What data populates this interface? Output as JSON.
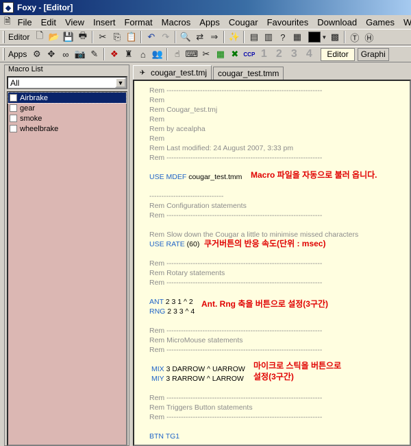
{
  "window": {
    "title": "Foxy - [Editor]"
  },
  "menu": [
    "File",
    "Edit",
    "View",
    "Insert",
    "Format",
    "Macros",
    "Apps",
    "Cougar",
    "Favourites",
    "Download",
    "Games",
    "W"
  ],
  "toolbar1": {
    "label": "Editor"
  },
  "toolbar2": {
    "label": "Apps",
    "numbers": [
      "1",
      "2",
      "3",
      "4"
    ],
    "editor_button": "Editor",
    "graphic_button": "Graphi"
  },
  "macro_panel": {
    "title": "Macro List",
    "filter": "All",
    "items": [
      {
        "label": "Airbrake",
        "selected": true
      },
      {
        "label": "gear",
        "selected": false
      },
      {
        "label": "smoke",
        "selected": false
      },
      {
        "label": "wheelbrake",
        "selected": false
      }
    ]
  },
  "tabs": [
    {
      "label": "cougar_test.tmj",
      "active": true
    },
    {
      "label": "cougar_test.tmm",
      "active": false
    }
  ],
  "editor": {
    "lines": {
      "l1": "Rem -----------------------------------------------------------------",
      "l2": "Rem",
      "l3": "Rem    Cougar_test.tmj",
      "l4": "Rem",
      "l5": "Rem    by acealpha",
      "l6": "Rem",
      "l7": "Rem    Last modified: 24 August 2007, 3:33 pm",
      "l8": "Rem -----------------------------------------------------------------",
      "use_mdef_kw": "USE MDEF",
      "use_mdef_val": "cougar_test.tmm",
      "l10": "-------------------------------",
      "l11": "Rem       Configuration statements",
      "l12": "Rem -----------------------------------------------------------------",
      "l13": "Rem Slow down the Cougar a little to minimise missed characters",
      "use_rate_kw": "USE RATE",
      "use_rate_val": "(60)",
      "l15": "Rem -----------------------------------------------------------------",
      "l16": "Rem         Rotary statements",
      "l17": "Rem -----------------------------------------------------------------",
      "ant_kw": "ANT",
      "ant_val": "2 3 1 ^ 2",
      "rng_kw": "RNG",
      "rng_val": "2 3 3 ^ 4",
      "l20": "Rem -----------------------------------------------------------------",
      "l21": "Rem       MicroMouse statements",
      "l22": "Rem -----------------------------------------------------------------",
      "mix_kw": "MIX",
      "mix_val": "3  DARROW ^ UARROW",
      "miy_kw": "MIY",
      "miy_val": "3  RARROW ^ LARROW",
      "l25": "Rem -----------------------------------------------------------------",
      "l26": "Rem       Triggers Button statements",
      "l27": "Rem -----------------------------------------------------------------",
      "btn_kw": "BTN TG1"
    },
    "notes": {
      "n1": "Macro 파일을 자동으로 불러 옵니다.",
      "n2": "쿠거버튼의 반응 속도(단위 : msec)",
      "n3": "Ant. Rng 축을 버튼으로 설정(3구간)",
      "n4a": "마이크로 스틱을 버튼으로",
      "n4b": "설정(3구간)"
    }
  },
  "colors": {
    "comment": "#8c8c8c",
    "keyword": "#1f64c8",
    "annotation": "#e00000",
    "editor_bg": "#fffee0",
    "list_bg": "#dbb7b3"
  }
}
